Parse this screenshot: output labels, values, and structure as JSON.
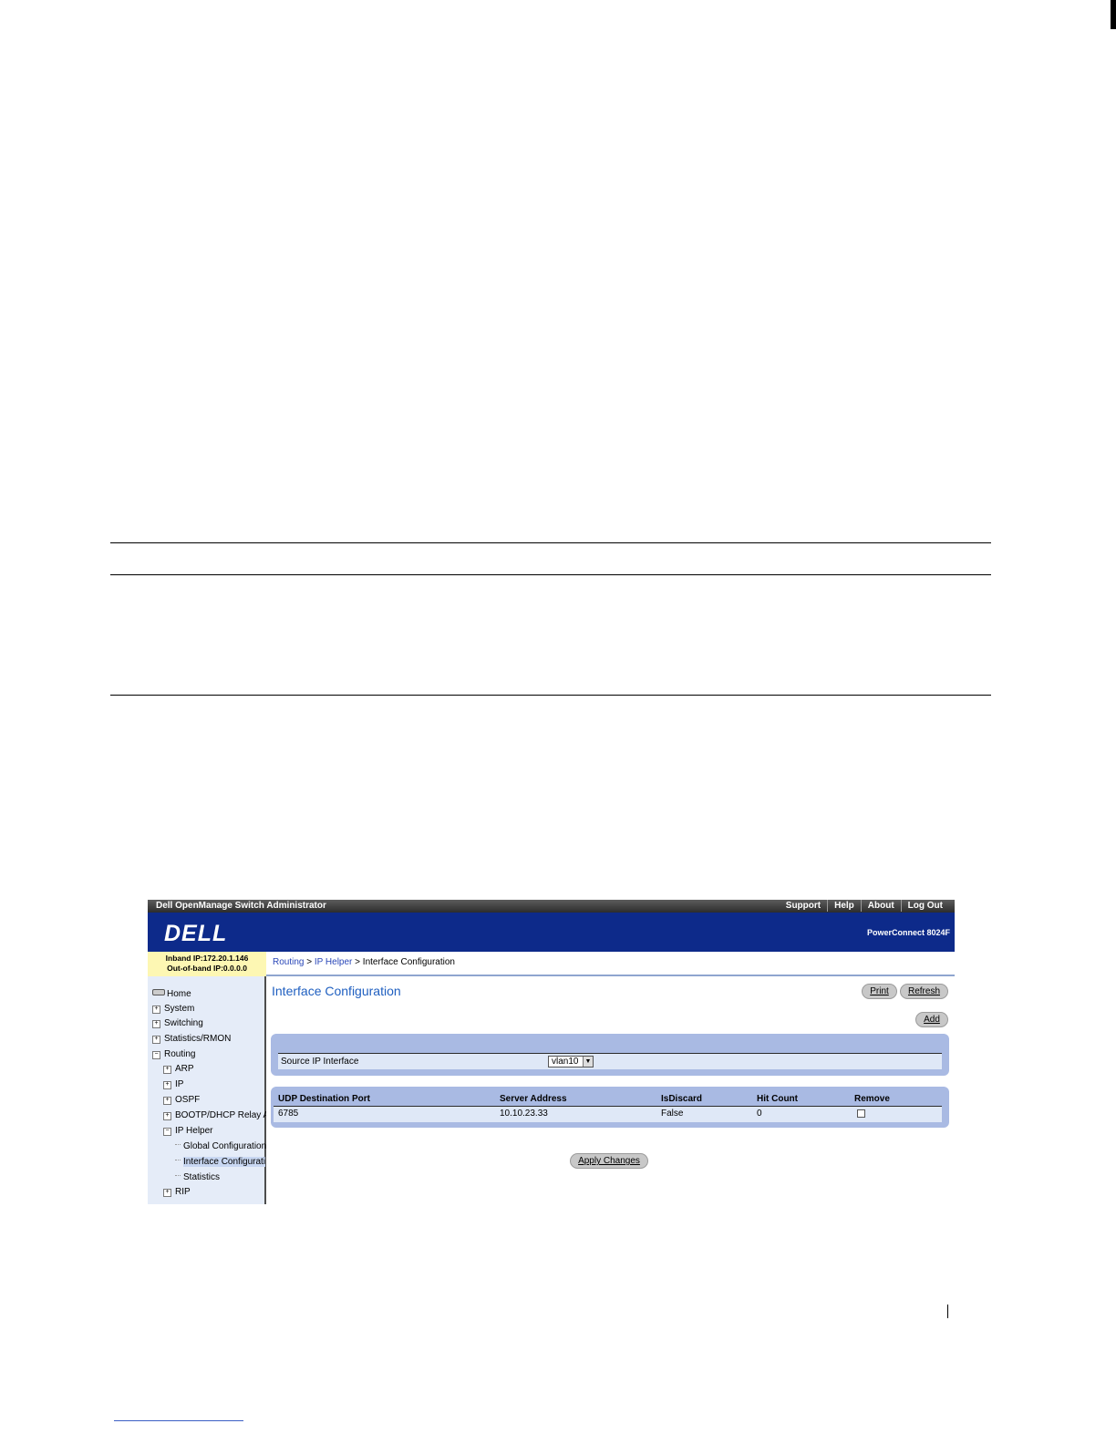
{
  "window": {
    "app_title": "Dell OpenManage Switch Administrator",
    "top_links": [
      "Support",
      "Help",
      "About",
      "Log Out"
    ],
    "logo": "DELL",
    "model": "PowerConnect 8024F"
  },
  "ip_info": {
    "inband": "Inband IP:172.20.1.146",
    "outofband": "Out-of-band IP:0.0.0.0"
  },
  "breadcrumb": {
    "item1": "Routing",
    "sep1": " > ",
    "item2": "IP Helper",
    "sep2": " > ",
    "current": "Interface Configuration"
  },
  "sidebar": {
    "home": "Home",
    "system": "System",
    "switching": "Switching",
    "stats": "Statistics/RMON",
    "routing": "Routing",
    "arp": "ARP",
    "ip": "IP",
    "ospf": "OSPF",
    "bootp": "BOOTP/DHCP Relay A",
    "iphelper": "IP Helper",
    "global": "Global Configuration",
    "interface": "Interface Configurati",
    "statistics": "Statistics",
    "rip": "RIP"
  },
  "main": {
    "title": "Interface Configuration",
    "print": "Print",
    "refresh": "Refresh",
    "add": "Add",
    "source_label": "Source IP Interface",
    "source_value": "vlan10",
    "apply": "Apply Changes"
  },
  "table": {
    "headers": [
      "UDP Destination Port",
      "Server Address",
      "IsDiscard",
      "Hit Count",
      "Remove"
    ],
    "rows": [
      {
        "port": "6785",
        "server": "10.10.23.33",
        "discard": "False",
        "hits": "0",
        "remove": false
      }
    ]
  }
}
